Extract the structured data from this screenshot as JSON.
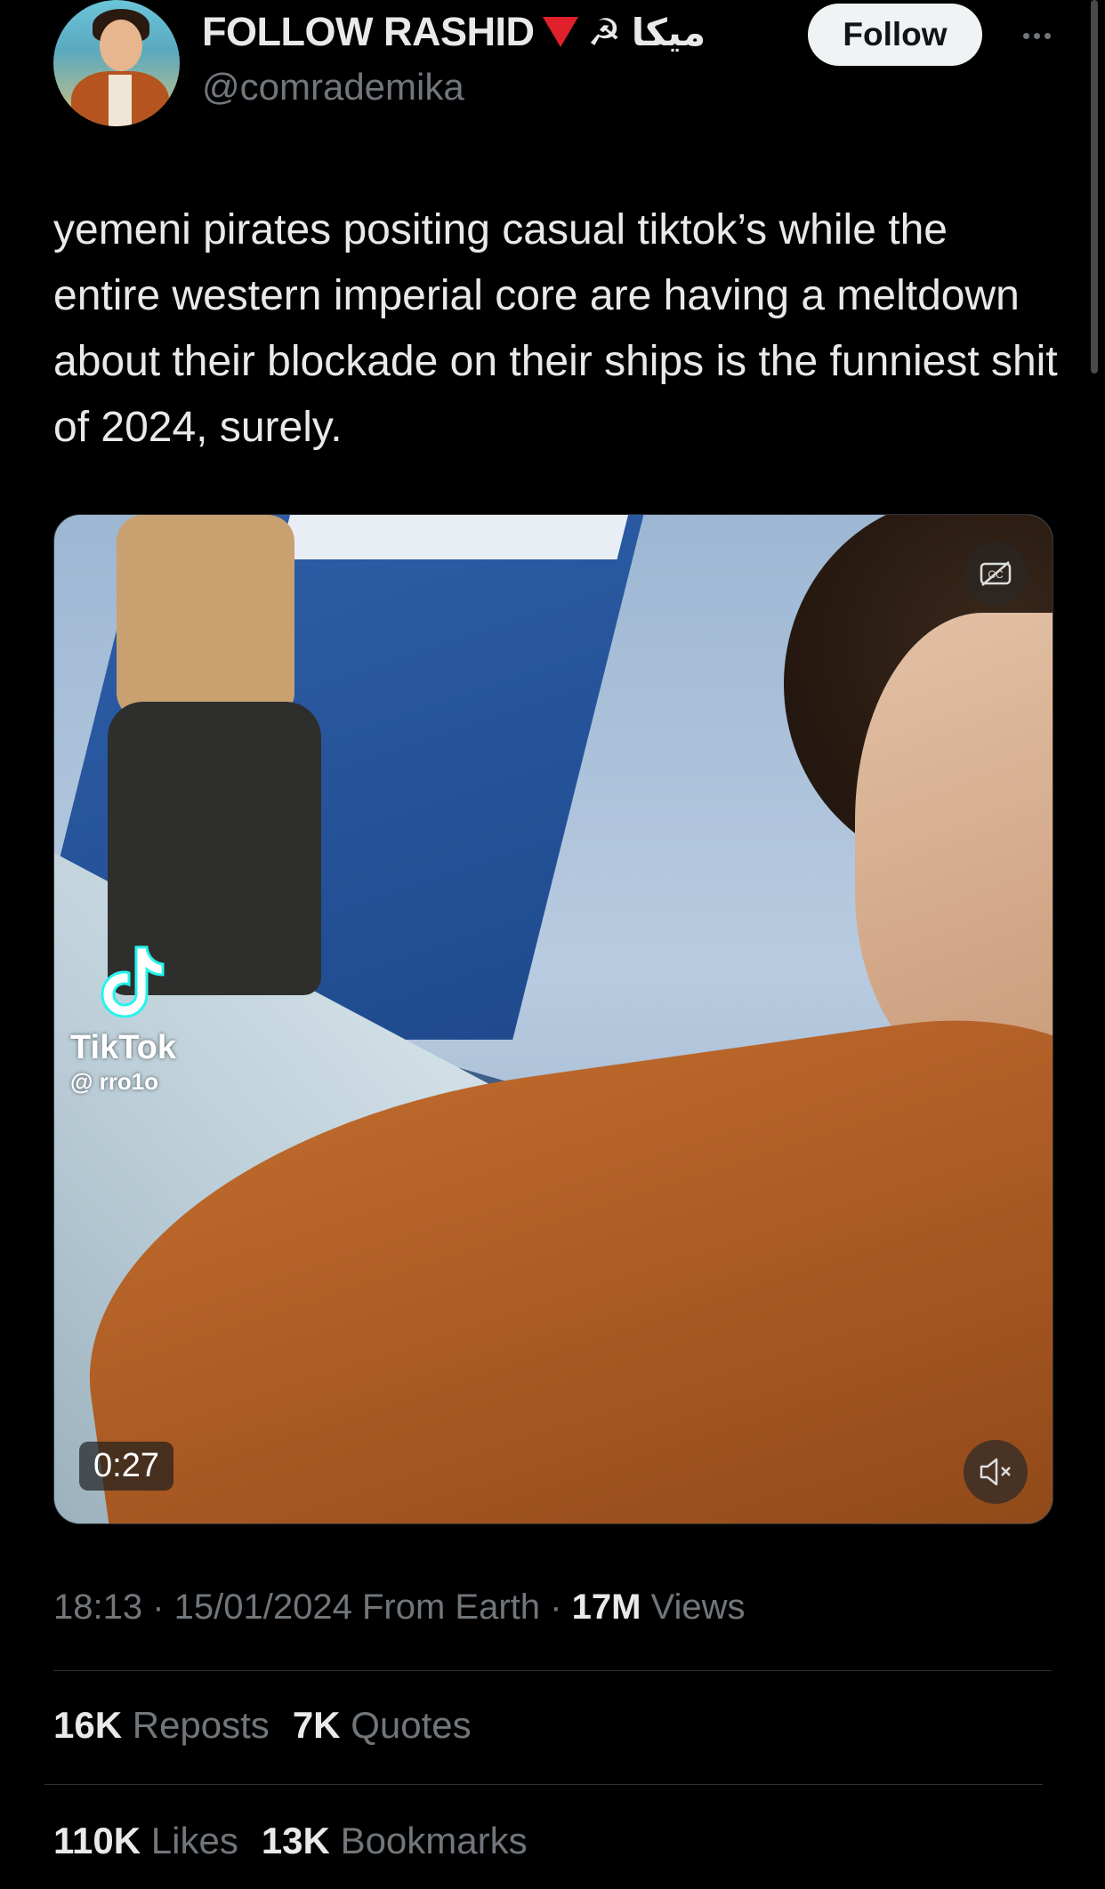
{
  "author": {
    "display_name": "FOLLOW RASHID",
    "name_suffix": "☭ میکا",
    "handle": "@comrademika",
    "follow_label": "Follow"
  },
  "tweet": {
    "text": "yemeni pirates positing casual tiktok’s while the entire western imperial core are having a meltdown about their blockade on their ships is the funniest shit of 2024, surely."
  },
  "media": {
    "watermark_brand": "TikTok",
    "watermark_user": "@ rro1o",
    "duration": "0:27"
  },
  "meta": {
    "time": "18:13",
    "date": "15/01/2024",
    "source": "From Earth",
    "views_count": "17M",
    "views_label": "Views"
  },
  "stats": {
    "reposts_count": "16K",
    "reposts_label": "Reposts",
    "quotes_count": "7K",
    "quotes_label": "Quotes",
    "likes_count": "110K",
    "likes_label": "Likes",
    "bookmarks_count": "13K",
    "bookmarks_label": "Bookmarks"
  },
  "colors": {
    "background": "#000000",
    "text_primary": "#e7e9ea",
    "text_secondary": "#71767b",
    "divider": "#2f3336",
    "follow_button_bg": "#eff3f4",
    "follow_button_text": "#0f1419",
    "flag_red": "#e0202a"
  }
}
